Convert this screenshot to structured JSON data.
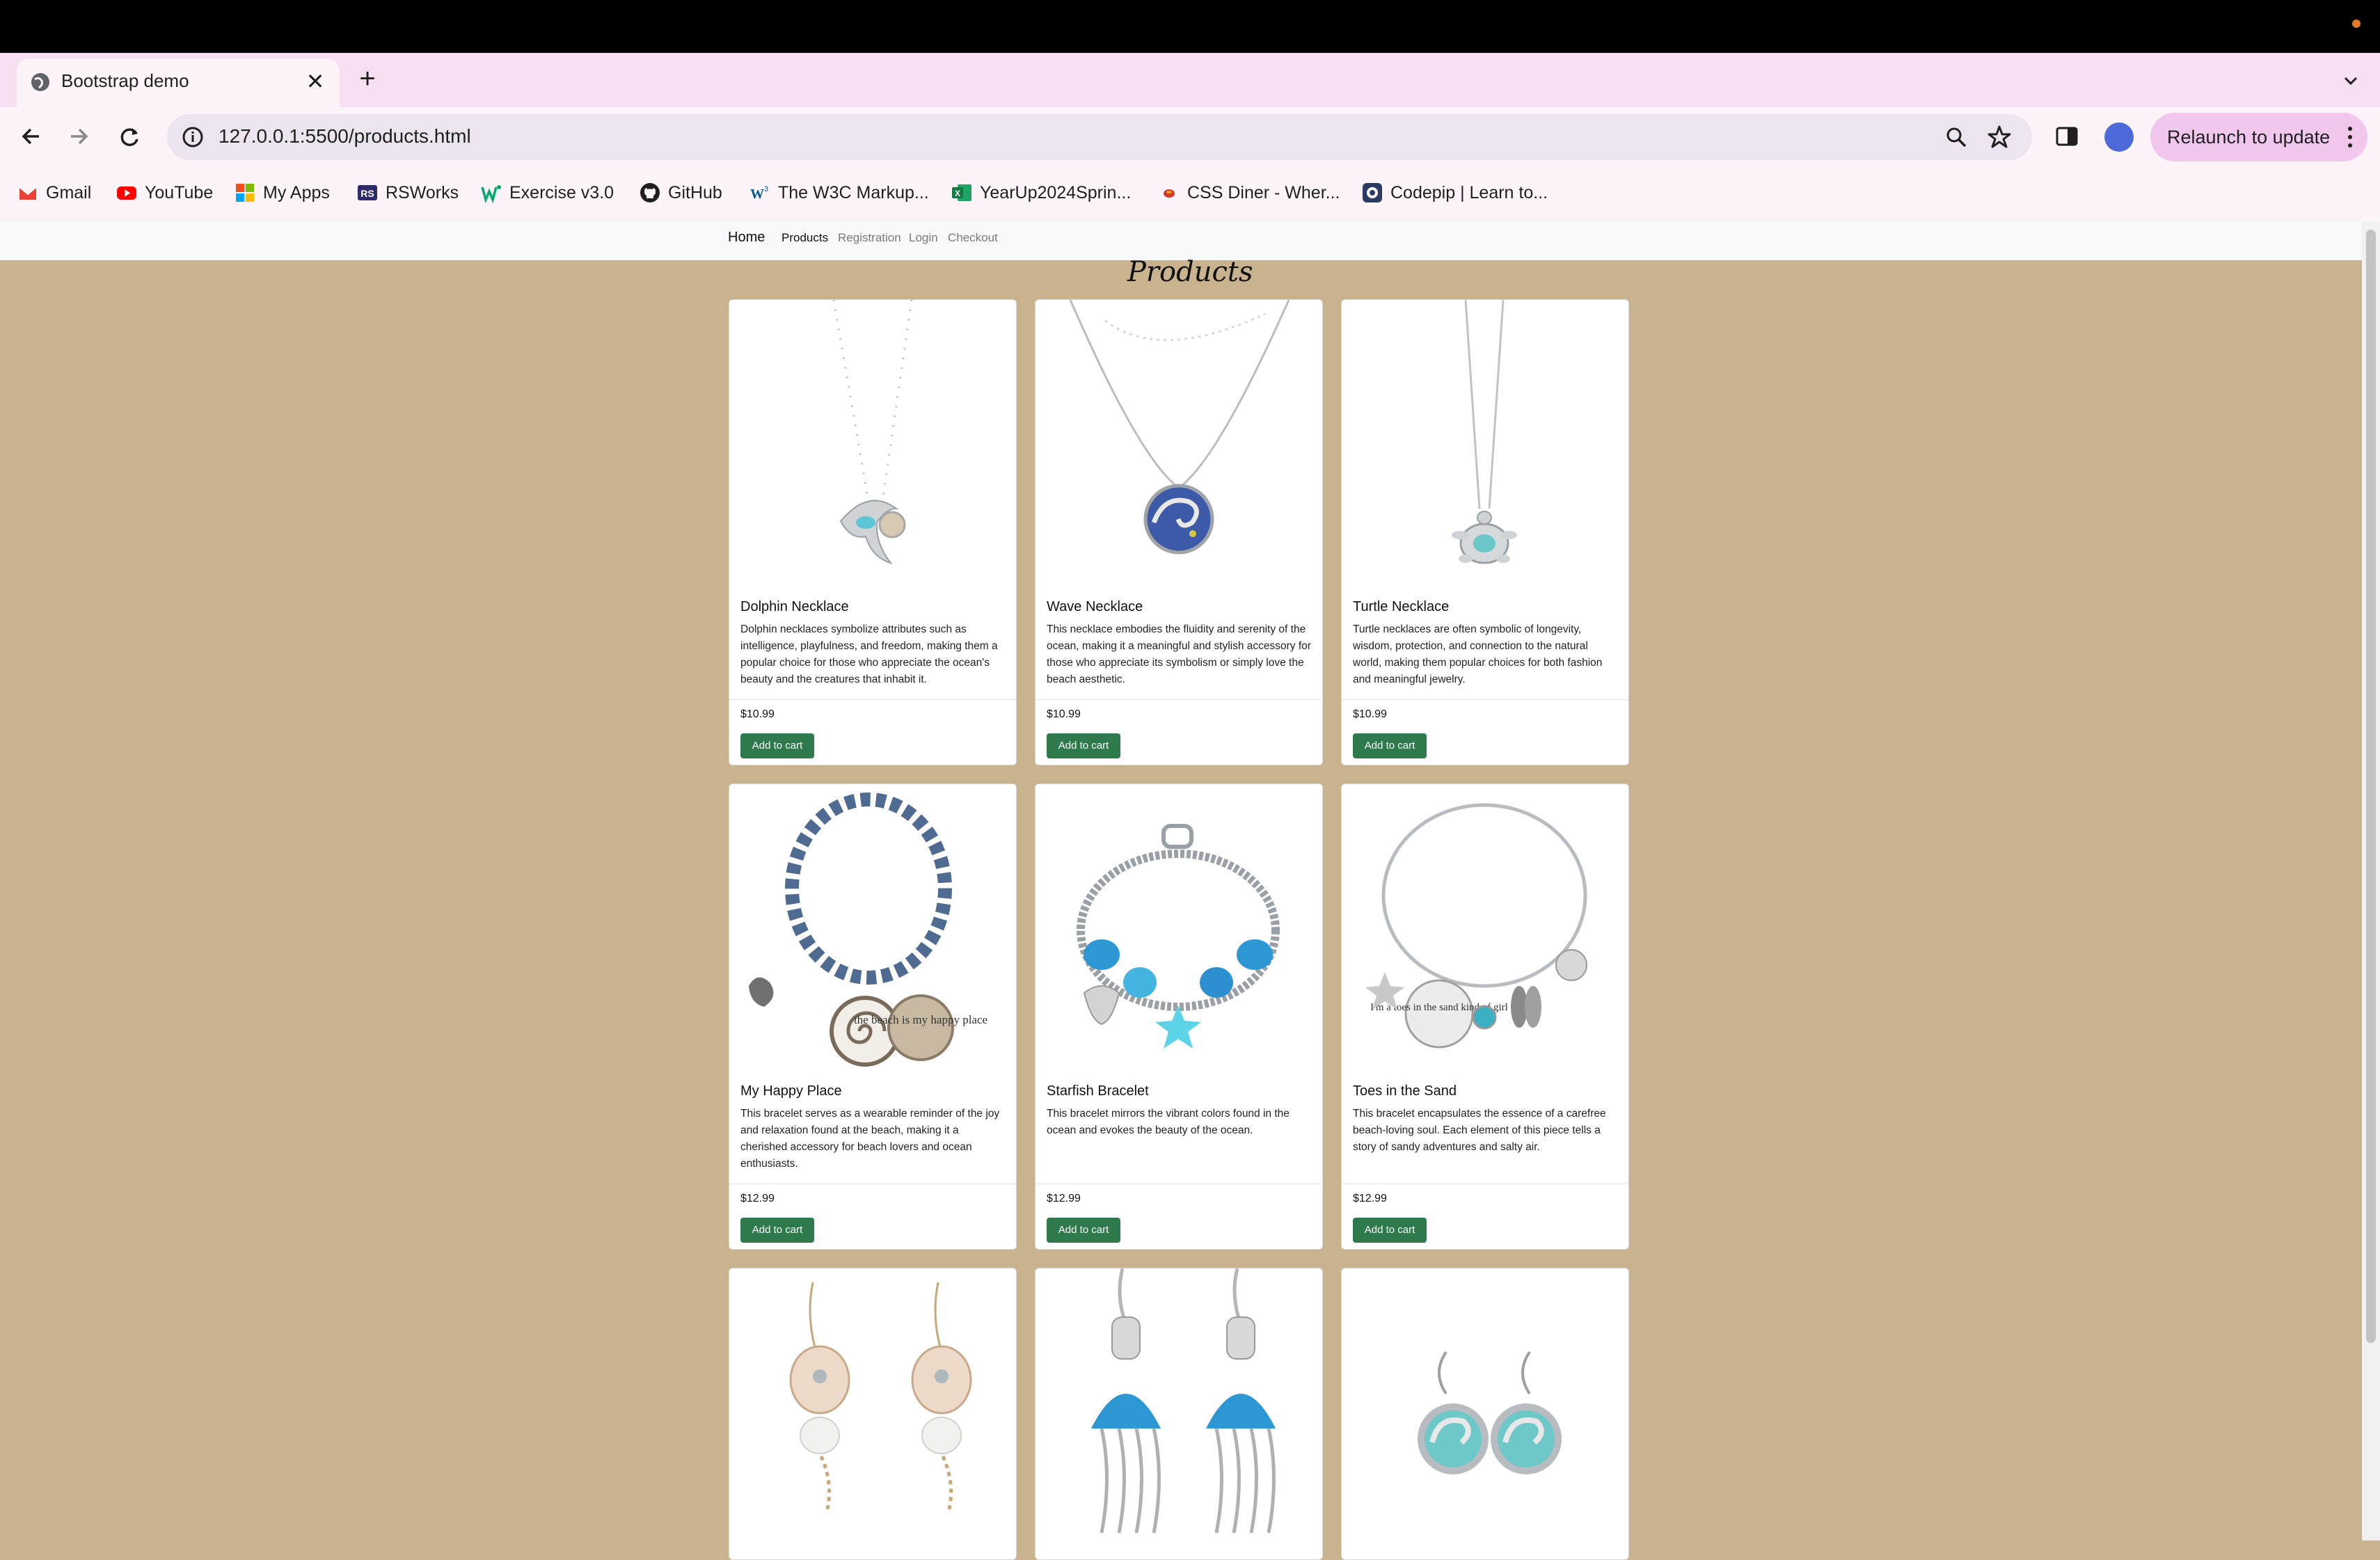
{
  "browser": {
    "tab_title": "Bootstrap demo",
    "url": "127.0.0.1:5500/products.html",
    "relaunch_label": "Relaunch to update",
    "bookmarks": [
      "Gmail",
      "YouTube",
      "My Apps",
      "RSWorks",
      "Exercise v3.0",
      "GitHub",
      "The W3C Markup...",
      "YearUp2024Sprin...",
      "CSS Diner - Wher...",
      "Codepip | Learn to..."
    ]
  },
  "nav": {
    "home": "Home",
    "products": "Products",
    "registration": "Registration",
    "login": "Login",
    "checkout": "Checkout"
  },
  "page_title": "Products",
  "products": [
    {
      "name": "Dolphin Necklace",
      "desc": "Dolphin necklaces symbolize attributes such as intelligence, playfulness, and freedom, making them a popular choice for those who appreciate the ocean's beauty and the creatures that inhabit it.",
      "price": "$10.99",
      "button": "Add to cart"
    },
    {
      "name": "Wave Necklace",
      "desc": "This necklace embodies the fluidity and serenity of the ocean, making it a meaningful and stylish accessory for those who appreciate its symbolism or simply love the beach aesthetic.",
      "price": "$10.99",
      "button": "Add to cart"
    },
    {
      "name": "Turtle Necklace",
      "desc": "Turtle necklaces are often symbolic of longevity, wisdom, protection, and connection to the natural world, making them popular choices for both fashion and meaningful jewelry.",
      "price": "$10.99",
      "button": "Add to cart"
    },
    {
      "name": "My Happy Place",
      "desc": "This bracelet serves as a wearable reminder of the joy and relaxation found at the beach, making it a cherished accessory for beach lovers and ocean enthusiasts.",
      "price": "$12.99",
      "button": "Add to cart"
    },
    {
      "name": "Starfish Bracelet",
      "desc": "This bracelet mirrors the vibrant colors found in the ocean and evokes the beauty of the ocean.",
      "price": "$12.99",
      "button": "Add to cart"
    },
    {
      "name": "Toes in the Sand",
      "desc": "This bracelet encapsulates the essence of a carefree beach-loving soul. Each element of this piece tells a story of sandy adventures and salty air.",
      "price": "$12.99",
      "button": "Add to cart"
    },
    {
      "name": "",
      "desc": "",
      "price": "",
      "button": ""
    },
    {
      "name": "",
      "desc": "",
      "price": "",
      "button": ""
    },
    {
      "name": "",
      "desc": "",
      "price": "",
      "button": ""
    }
  ],
  "image_pendants": {
    "bracelet_tag": "the beach is my happy place",
    "toes_tag": "I'm a toes in the sand kind of girl"
  },
  "colors": {
    "page_bg": "#c9b38f",
    "button": "#2f7a4c",
    "navbar": "#f8f9fa"
  }
}
